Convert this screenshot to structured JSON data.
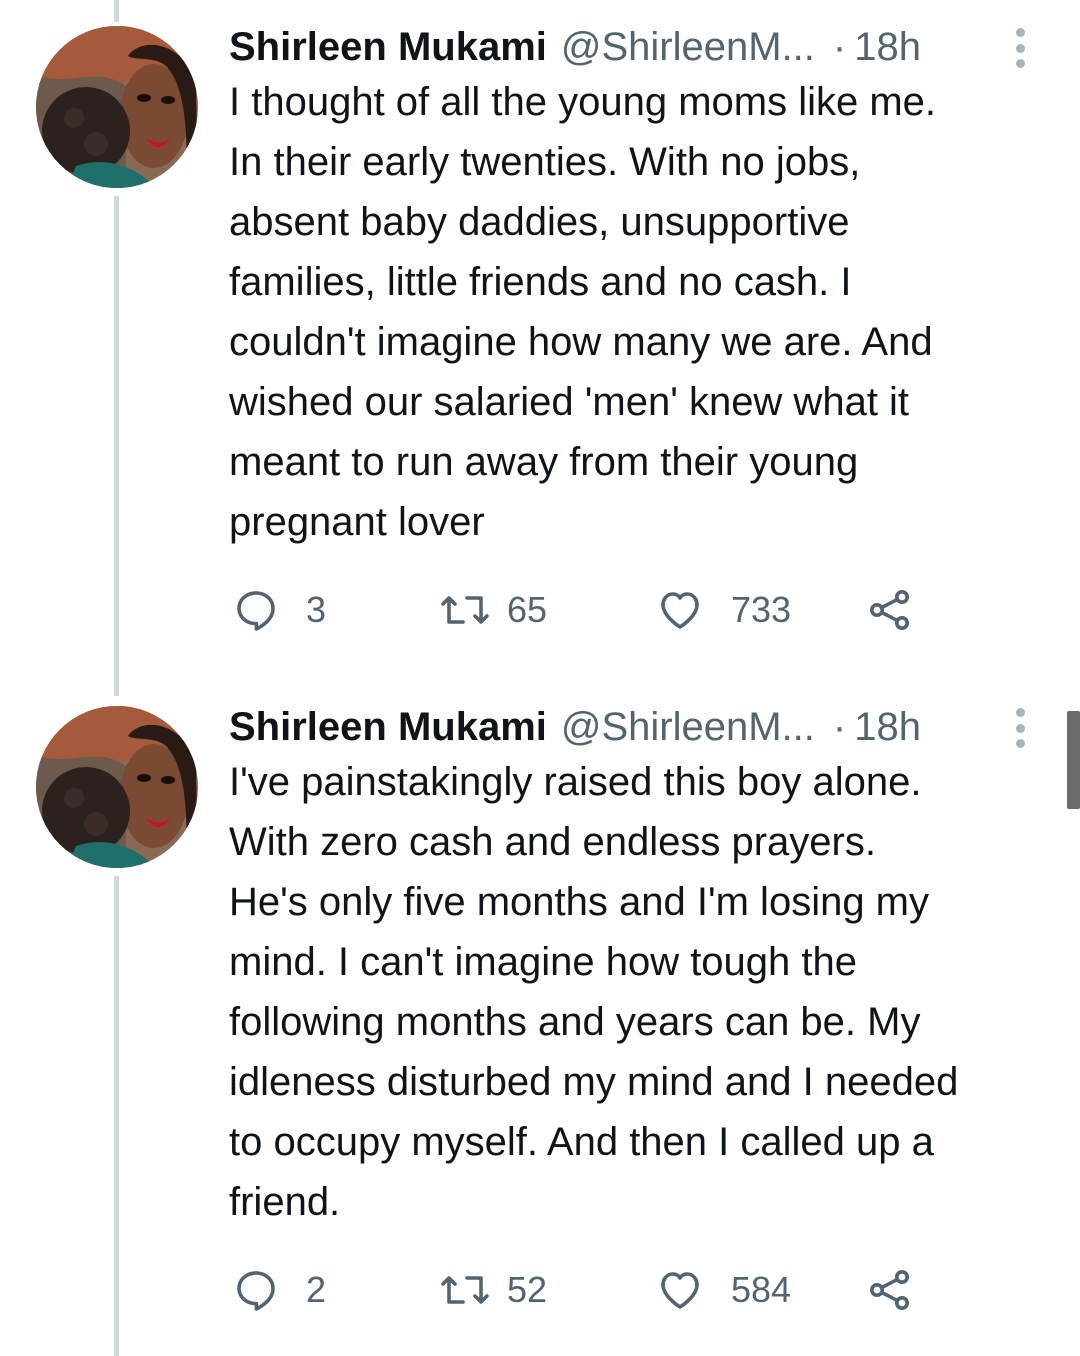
{
  "colors": {
    "text_primary": "#0f1419",
    "text_secondary": "#536471",
    "thread_line": "#cfd9de",
    "background": "#ffffff"
  },
  "tweets": [
    {
      "author": {
        "name": "Shirleen Mukami",
        "handle": "@ShirleenM...",
        "avatar_icon": "profile-photo"
      },
      "separator": "·",
      "time": "18h",
      "text_lines": [
        "I thought of all the young moms like me.",
        "In their early twenties. With no jobs,",
        "absent baby daddies, unsupportive",
        "families, little friends and no cash. I",
        "couldn't imagine how many we are. And",
        "wished our salaried 'men' knew what it",
        "meant to run away from their young",
        "pregnant lover"
      ],
      "actions": {
        "replies": "3",
        "retweets": "65",
        "likes": "733"
      }
    },
    {
      "author": {
        "name": "Shirleen Mukami",
        "handle": "@ShirleenM...",
        "avatar_icon": "profile-photo"
      },
      "separator": "·",
      "time": "18h",
      "text_lines": [
        "I've painstakingly raised this boy alone.",
        "With zero cash and endless prayers.",
        "He's only five months and I'm losing my",
        "mind. I can't imagine how tough the",
        "following months and years can be. My",
        "idleness disturbed my mind and I needed",
        "to occupy myself. And then I called up a",
        "friend."
      ],
      "actions": {
        "replies": "2",
        "retweets": "52",
        "likes": "584"
      }
    }
  ],
  "icons": {
    "reply": "reply-icon",
    "retweet": "retweet-icon",
    "like": "like-icon",
    "share": "share-icon",
    "more": "more-options-icon"
  }
}
